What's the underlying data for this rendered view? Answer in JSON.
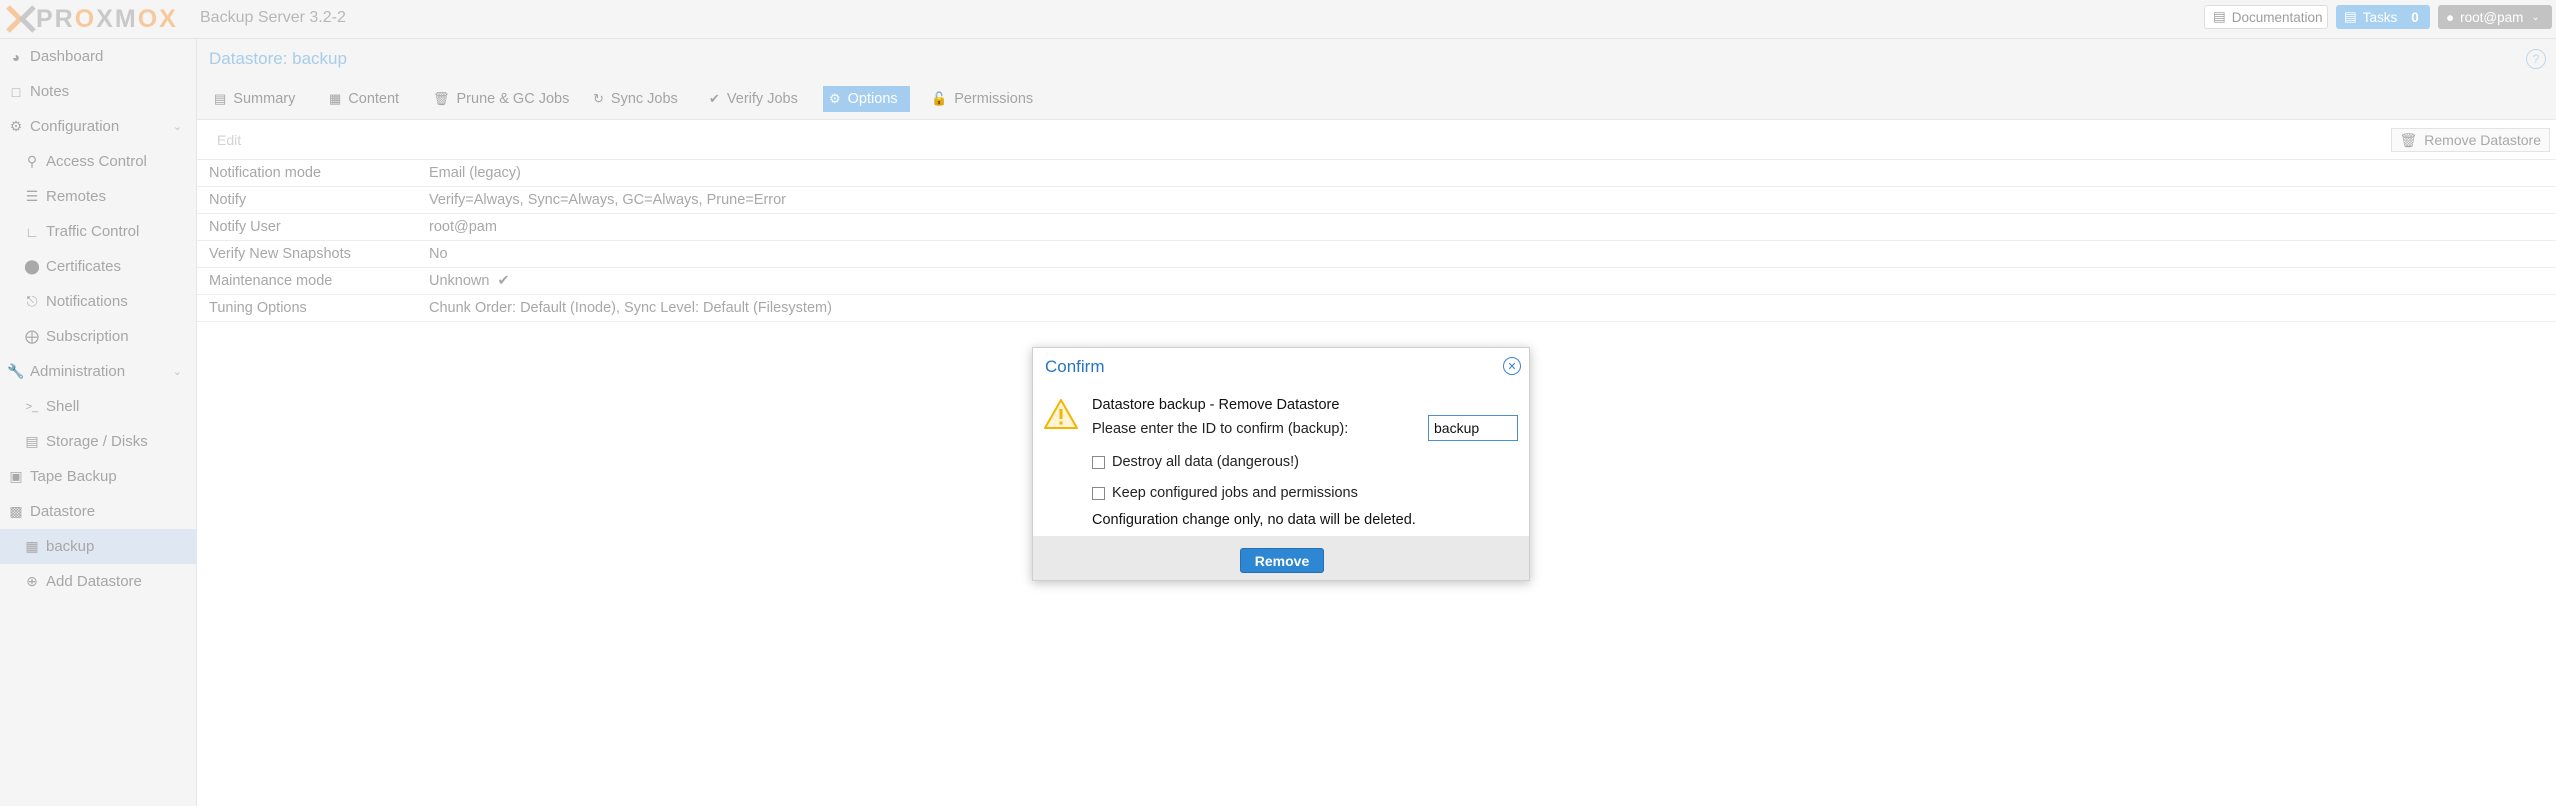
{
  "header": {
    "logo_text_pr": "PR",
    "logo_text_o": "O",
    "logo_text_xm": "XM",
    "logo_text_o2": "O",
    "logo_text_x": "X",
    "product_title": "Backup Server 3.2-2",
    "documentation_label": "Documentation",
    "tasks_label": "Tasks",
    "tasks_count": "0",
    "user_label": "root@pam"
  },
  "sidebar": {
    "items": [
      {
        "label": "Dashboard",
        "icon": "tachometer-icon"
      },
      {
        "label": "Notes",
        "icon": "notes-icon"
      },
      {
        "label": "Configuration",
        "icon": "gears-icon"
      },
      {
        "label": "Access Control",
        "icon": "key-icon"
      },
      {
        "label": "Remotes",
        "icon": "server-icon"
      },
      {
        "label": "Traffic Control",
        "icon": "signal-icon"
      },
      {
        "label": "Certificates",
        "icon": "certificate-icon"
      },
      {
        "label": "Notifications",
        "icon": "bell-icon"
      },
      {
        "label": "Subscription",
        "icon": "support-icon"
      },
      {
        "label": "Administration",
        "icon": "wrench-icon"
      },
      {
        "label": "Shell",
        "icon": "terminal-icon"
      },
      {
        "label": "Storage / Disks",
        "icon": "hdd-icon"
      },
      {
        "label": "Tape Backup",
        "icon": "tape-icon"
      },
      {
        "label": "Datastore",
        "icon": "archive-icon"
      },
      {
        "label": "backup",
        "icon": "datastore-icon"
      },
      {
        "label": "Add Datastore",
        "icon": "plus-circle-icon"
      }
    ]
  },
  "main": {
    "title": "Datastore: backup",
    "tabs": [
      {
        "label": "Summary"
      },
      {
        "label": "Content"
      },
      {
        "label": "Prune & GC Jobs"
      },
      {
        "label": "Sync Jobs"
      },
      {
        "label": "Verify Jobs"
      },
      {
        "label": "Options"
      },
      {
        "label": "Permissions"
      }
    ],
    "edit_label": "Edit",
    "remove_datastore_label": "Remove Datastore",
    "options": [
      {
        "label": "Notification mode",
        "value": "Email (legacy)"
      },
      {
        "label": "Notify",
        "value": "Verify=Always, Sync=Always, GC=Always, Prune=Error"
      },
      {
        "label": "Notify User",
        "value": "root@pam"
      },
      {
        "label": "Verify New Snapshots",
        "value": "No"
      },
      {
        "label": "Maintenance mode",
        "value": "Unknown"
      },
      {
        "label": "Tuning Options",
        "value": "Chunk Order: Default (Inode), Sync Level: Default (Filesystem)"
      }
    ]
  },
  "dialog": {
    "title": "Confirm",
    "heading": "Datastore backup - Remove Datastore",
    "prompt": "Please enter the ID to confirm (backup):",
    "input_value": "backup",
    "checkbox_destroy": "Destroy all data (dangerous!)",
    "checkbox_keep": "Keep configured jobs and permissions",
    "note": "Configuration change only, no data will be deleted.",
    "remove_label": "Remove"
  },
  "colors": {
    "accent": "#2e87d2",
    "tab_active": "#a4cdf0",
    "logo_orange": "#f6c89c",
    "warning": "#f4b400"
  }
}
